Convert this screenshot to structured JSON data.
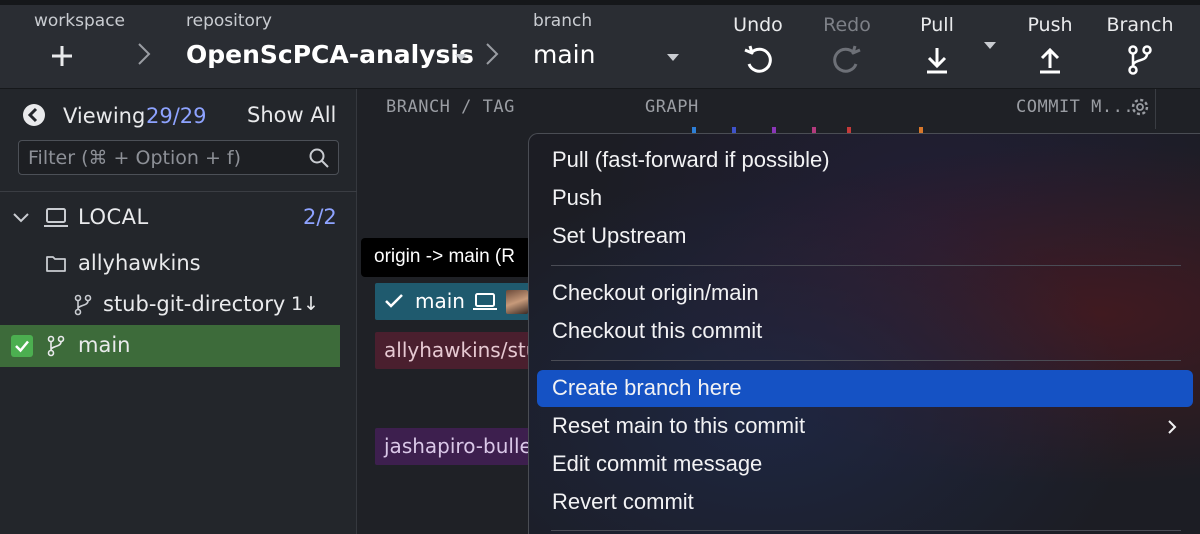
{
  "toolbar": {
    "workspace_label": "workspace",
    "repository_label": "repository",
    "repository_name": "OpenScPCA-analysis",
    "branch_label": "branch",
    "branch_name": "main",
    "undo_label": "Undo",
    "redo_label": "Redo",
    "pull_label": "Pull",
    "push_label": "Push",
    "branch_button_label": "Branch"
  },
  "sidebar": {
    "viewing_label": "Viewing",
    "viewing_count": "29/29",
    "show_all_label": "Show All",
    "filter_placeholder": "Filter (⌘ + Option + f)",
    "local_section": {
      "label": "LOCAL",
      "count": "2/2"
    },
    "folder": {
      "label": "allyhawkins"
    },
    "branch_stub": {
      "label": "stub-git-directory",
      "behind": "1↓"
    },
    "branch_main": {
      "label": "main"
    }
  },
  "graph": {
    "col_branch_tag": "BRANCH / TAG",
    "col_graph": "GRAPH",
    "col_commit_message": "COMMIT M...",
    "tooltip": "origin -> main (R",
    "tags": [
      {
        "label": "main",
        "color": "#1f5a6e"
      },
      {
        "label": "allyhawkins/stub-git-directory",
        "color": "#4a1f2e"
      },
      {
        "label": "jashapiro-bulleted",
        "color": "#3d1f4e"
      }
    ]
  },
  "context_menu": {
    "items": [
      {
        "label": "Pull (fast-forward if possible)"
      },
      {
        "label": "Push"
      },
      {
        "label": "Set Upstream"
      },
      {
        "label": "Checkout origin/main"
      },
      {
        "label": "Checkout this commit"
      },
      {
        "label": "Create branch here"
      },
      {
        "label": "Reset main to this commit"
      },
      {
        "label": "Edit commit message"
      },
      {
        "label": "Revert commit"
      }
    ],
    "highlight_color": "#1552c4"
  }
}
